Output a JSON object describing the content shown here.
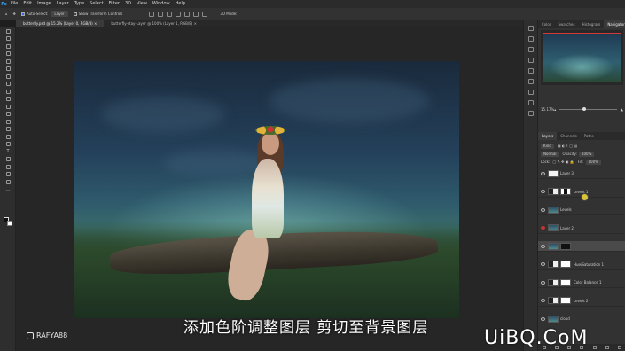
{
  "menubar": {
    "items": [
      "File",
      "Edit",
      "Image",
      "Layer",
      "Type",
      "Select",
      "Filter",
      "3D",
      "View",
      "Window",
      "Help"
    ]
  },
  "options": {
    "auto_select_label": "Auto-Select:",
    "auto_select_value": "Layer",
    "show_transform_label": "Show Transform Controls",
    "mode_3d_label": "3D Mode:"
  },
  "tabs": [
    {
      "label": "butterfly.psd @ 15.2% (Layer 0, RGB/8) ×",
      "active": true
    },
    {
      "label": "butterfly-stay-Layer @ 100% (Layer 1, RGB/8) ×",
      "active": false
    }
  ],
  "right_panel": {
    "top_tabs": [
      "Color",
      "Swatches",
      "Histogram",
      "Navigator"
    ],
    "active_top_tab": "Navigator",
    "zoom": "15.17%",
    "layers_tabs": [
      "Layers",
      "Channels",
      "Paths"
    ],
    "kind_label": "Kind",
    "blend_mode": "Normal",
    "opacity_label": "Opacity:",
    "opacity_value": "100%",
    "lock_label": "Lock:",
    "fill_label": "Fill:",
    "fill_value": "100%",
    "layers": [
      {
        "name": "Layer 3",
        "thumb": "white",
        "mask": "none",
        "selected": false,
        "red_eye": false
      },
      {
        "name": "Levels 1",
        "thumb": "adj",
        "mask": "mix",
        "selected": false,
        "red_eye": false
      },
      {
        "name": "Levels",
        "thumb": "img",
        "mask": "none",
        "selected": false,
        "red_eye": false
      },
      {
        "name": "Layer 2",
        "thumb": "img",
        "mask": "none",
        "selected": false,
        "red_eye": true
      },
      {
        "name": "",
        "thumb": "img",
        "mask": "blk",
        "selected": true,
        "red_eye": false
      },
      {
        "name": "Hue/Saturation 1",
        "thumb": "adj",
        "mask": "white",
        "selected": false,
        "red_eye": false
      },
      {
        "name": "Color Balance 1",
        "thumb": "adj",
        "mask": "white",
        "selected": false,
        "red_eye": false
      },
      {
        "name": "Levels 2",
        "thumb": "adj",
        "mask": "white",
        "selected": false,
        "red_eye": false
      },
      {
        "name": "cloud",
        "thumb": "img",
        "mask": "none",
        "selected": false,
        "red_eye": false
      }
    ]
  },
  "overlay": {
    "subtitle": "添加色阶调整图层 剪切至背景图层",
    "rafya": "RAFYA88",
    "uibq": "UiBQ.CoM"
  },
  "colors": {
    "accent": "#31a8ff",
    "selected_layer": "#4a4a4a",
    "navigator_frame": "#d23a3a"
  }
}
